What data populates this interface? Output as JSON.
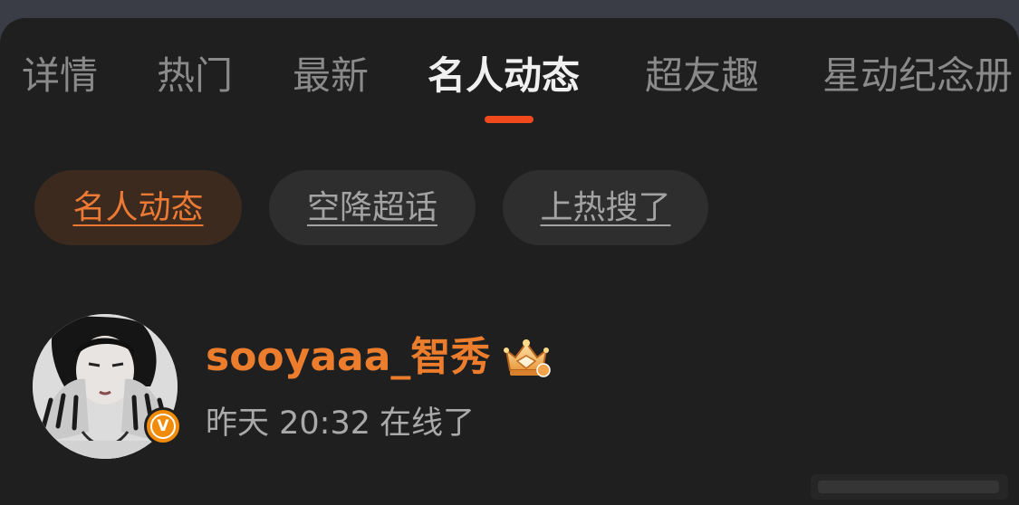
{
  "tabs": [
    {
      "label": "详情"
    },
    {
      "label": "热门"
    },
    {
      "label": "最新"
    },
    {
      "label": "名人动态"
    },
    {
      "label": "超友趣"
    },
    {
      "label": "星动纪念册"
    }
  ],
  "active_tab": "名人动态",
  "filter_chips": [
    {
      "label": "名人动态"
    },
    {
      "label": "空降超话"
    },
    {
      "label": "上热搜了"
    }
  ],
  "active_chip": "名人动态",
  "post": {
    "username": "sooyaaa_智秀",
    "time": "昨天 20:32",
    "status": "在线了",
    "verified_badge": "V"
  },
  "colors": {
    "accent": "#f04a1c",
    "username": "#eb7d2c",
    "background": "#1f1f1f",
    "chip_active_bg": "#3b2a1d",
    "chip_bg": "#2e2e2e"
  },
  "icons": {
    "crown": "crown-badge-icon",
    "verified": "verified-v-icon"
  }
}
